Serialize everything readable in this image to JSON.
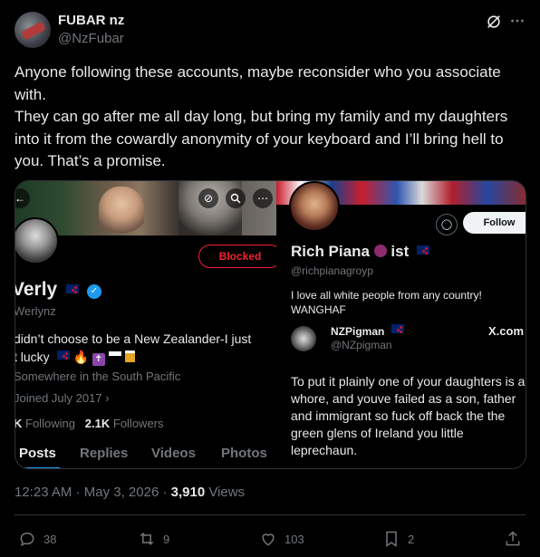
{
  "author": {
    "name": "FUBAR nz",
    "handle": "@NzFubar"
  },
  "tweet": {
    "paragraph1": "Anyone following these accounts, maybe reconsider who you associate with.",
    "paragraph2": "They can go after me all day long, but bring my family and my daughters into it from the cowardly anonymity of your keyboard and I’ll bring hell to you. That’s a promise."
  },
  "left_profile": {
    "blocked_label": "Blocked",
    "name": "Verly",
    "handle": "Werlynz",
    "bio_line1": "didn’t choose to be a New Zealander-I just",
    "bio_line2": "t lucky",
    "location": "Somewhere in the South Pacific",
    "joined": "Joined July 2017",
    "following_count": "K",
    "following_label": "Following",
    "followers_count": "2.1K",
    "followers_label": "Followers",
    "tabs": [
      "Posts",
      "Replies",
      "Videos",
      "Photos"
    ]
  },
  "right_profile": {
    "follow_label": "Follow",
    "name": "Rich Piana",
    "name_suffix": "ist",
    "handle": "@richpianagroyp",
    "bio_line1": "I love all white people from any country!",
    "bio_line2": "WANGHAF",
    "embedded_name": "NZPigman",
    "embedded_handle": "@NZpigman",
    "embedded_source": "X.com",
    "embedded_text": "To put it plainly one of your daughters is a whore, and youve failed as a son, father and immigrant so fuck off back the the green glens of Ireland you little leprechaun."
  },
  "meta": {
    "time": "12:23 AM",
    "separator1": " · ",
    "date": "May 3, 2026",
    "separator2": " · ",
    "views_count": "3,910",
    "views_label": " Views"
  },
  "actions": {
    "replies": "38",
    "reposts": "9",
    "likes": "103",
    "bookmarks": "2"
  },
  "colors": {
    "background": "#000000",
    "text": "#e7e9ea",
    "muted": "#71767b",
    "accent": "#1d9bf0",
    "blocked": "#f4212e"
  }
}
